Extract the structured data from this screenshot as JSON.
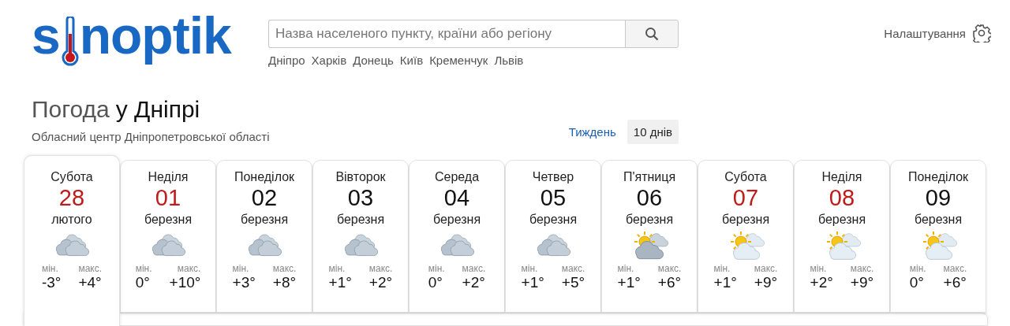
{
  "logo": {
    "text_start": "s",
    "text_end": "noptik"
  },
  "search": {
    "placeholder": "Назва населеного пункту, країни або регіону"
  },
  "cities": [
    "Дніпро",
    "Харків",
    "Донець",
    "Київ",
    "Кременчук",
    "Львів"
  ],
  "settings": {
    "label": "Налаштування"
  },
  "title": {
    "prefix": "Погода",
    "place": "у Дніпрі"
  },
  "subtitle": "Обласний центр Дніпропетровської області",
  "periods": [
    {
      "label": "Тиждень",
      "selected": false
    },
    {
      "label": "10 днів",
      "selected": true
    }
  ],
  "days": [
    {
      "weekday": "Субота",
      "date": "28",
      "month": "лютого",
      "weekend": true,
      "selected": true,
      "kind": "overcast",
      "min_label": "мін.",
      "min": "-3°",
      "max_label": "макс.",
      "max": "+4°"
    },
    {
      "weekday": "Неділя",
      "date": "01",
      "month": "березня",
      "weekend": true,
      "selected": false,
      "kind": "overcast",
      "min_label": "мін.",
      "min": "0°",
      "max_label": "макс.",
      "max": "+10°"
    },
    {
      "weekday": "Понеділок",
      "date": "02",
      "month": "березня",
      "weekend": false,
      "selected": false,
      "kind": "overcast",
      "min_label": "мін.",
      "min": "+3°",
      "max_label": "макс.",
      "max": "+8°"
    },
    {
      "weekday": "Вівторок",
      "date": "03",
      "month": "березня",
      "weekend": false,
      "selected": false,
      "kind": "overcast",
      "min_label": "мін.",
      "min": "+1°",
      "max_label": "макс.",
      "max": "+2°"
    },
    {
      "weekday": "Середа",
      "date": "04",
      "month": "березня",
      "weekend": false,
      "selected": false,
      "kind": "overcast",
      "min_label": "мін.",
      "min": "0°",
      "max_label": "макс.",
      "max": "+2°"
    },
    {
      "weekday": "Четвер",
      "date": "05",
      "month": "березня",
      "weekend": false,
      "selected": false,
      "kind": "overcast",
      "min_label": "мін.",
      "min": "+1°",
      "max_label": "макс.",
      "max": "+5°"
    },
    {
      "weekday": "П'ятниця",
      "date": "06",
      "month": "березня",
      "weekend": false,
      "selected": false,
      "kind": "sun_dark_cloud",
      "min_label": "мін.",
      "min": "+1°",
      "max_label": "макс.",
      "max": "+6°"
    },
    {
      "weekday": "Субота",
      "date": "07",
      "month": "березня",
      "weekend": true,
      "selected": false,
      "kind": "sun_cloud",
      "min_label": "мін.",
      "min": "+1°",
      "max_label": "макс.",
      "max": "+9°"
    },
    {
      "weekday": "Неділя",
      "date": "08",
      "month": "березня",
      "weekend": true,
      "selected": false,
      "kind": "sun_cloud",
      "min_label": "мін.",
      "min": "+2°",
      "max_label": "макс.",
      "max": "+9°"
    },
    {
      "weekday": "Понеділок",
      "date": "09",
      "month": "березня",
      "weekend": false,
      "selected": false,
      "kind": "sun_cloud",
      "min_label": "мін.",
      "min": "0°",
      "max_label": "макс.",
      "max": "+6°"
    }
  ]
}
